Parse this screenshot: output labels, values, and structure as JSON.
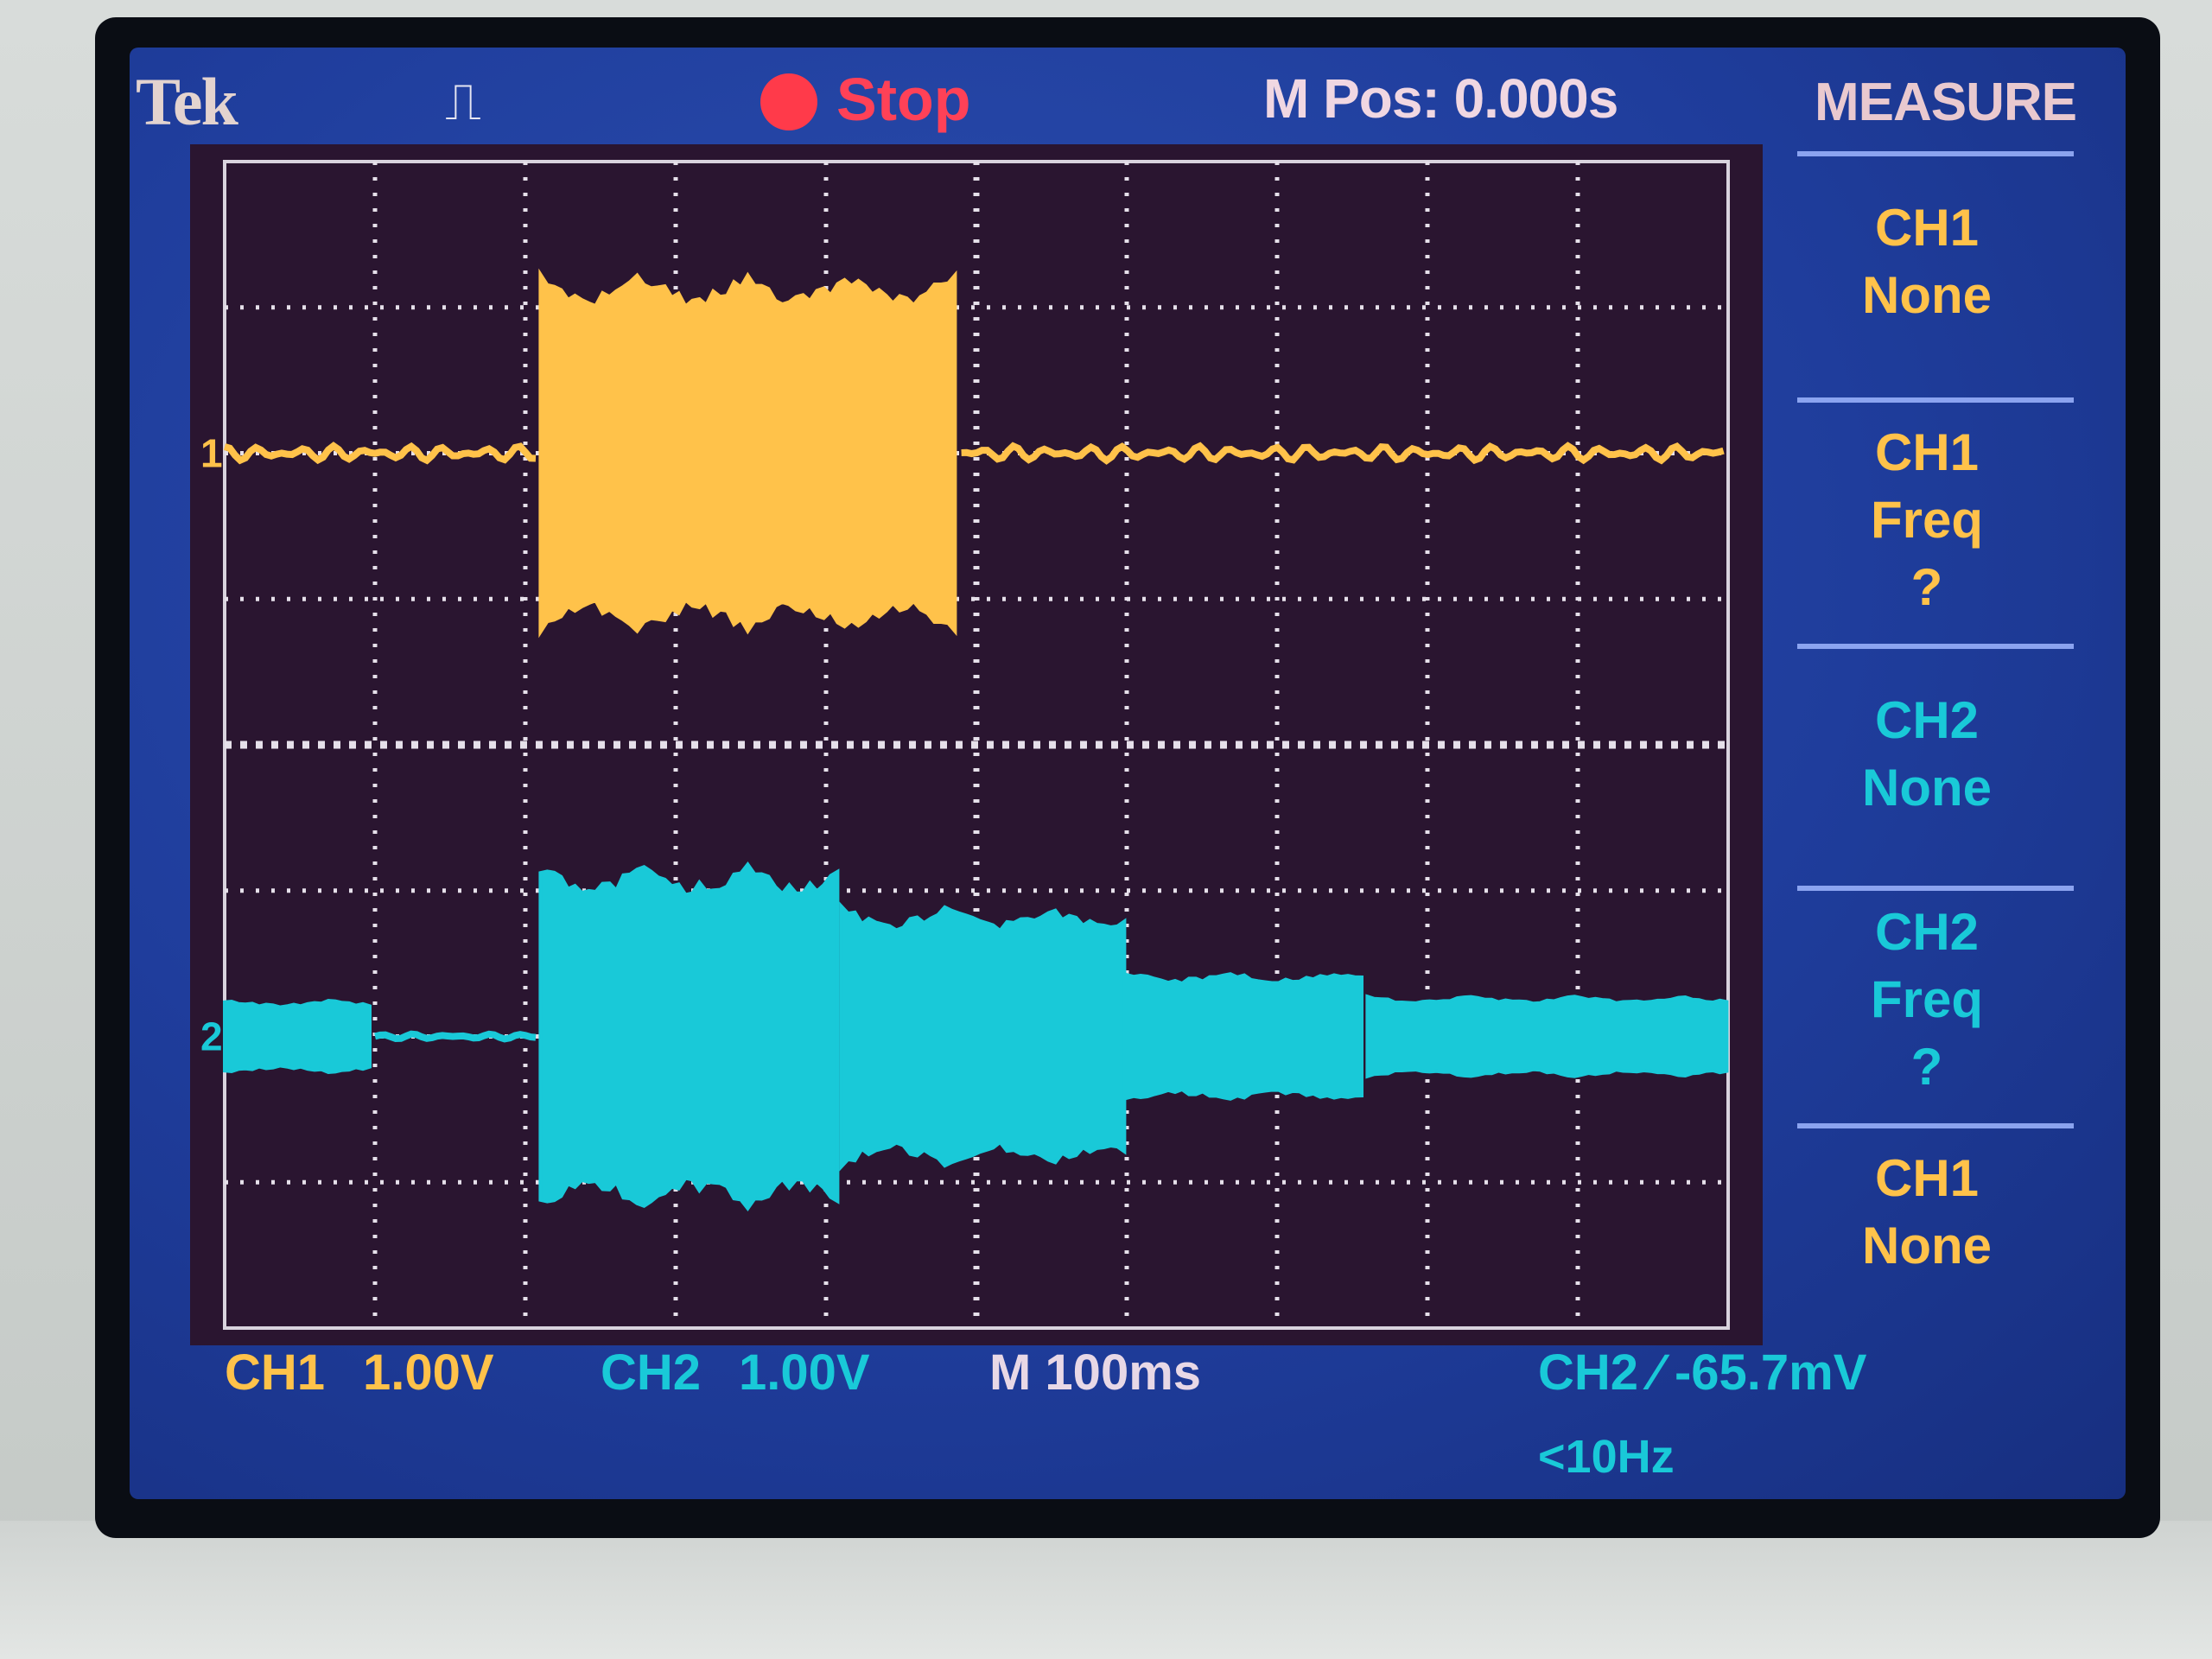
{
  "header": {
    "brand": "Tek",
    "trigger_glyph": "⎍",
    "run_state": "Stop",
    "horizontal_position": "M Pos: 0.000s"
  },
  "channels": {
    "ch1_marker": "1",
    "ch2_marker": "2"
  },
  "menu": {
    "title": "MEASURE",
    "items": [
      {
        "line1": "CH1",
        "line2": "None",
        "line3": "",
        "channel": "ch1"
      },
      {
        "line1": "CH1",
        "line2": "Freq",
        "line3": "?",
        "channel": "ch1"
      },
      {
        "line1": "CH2",
        "line2": "None",
        "line3": "",
        "channel": "ch2"
      },
      {
        "line1": "CH2",
        "line2": "Freq",
        "line3": "?",
        "channel": "ch2"
      },
      {
        "line1": "CH1",
        "line2": "None",
        "line3": "",
        "channel": "ch1"
      }
    ]
  },
  "status": {
    "ch1_label": "CH1",
    "ch1_scale": "1.00V",
    "ch2_label": "CH2",
    "ch2_scale": "1.00V",
    "timebase": "M 100ms",
    "trigger": "CH2 ⁄ -65.7mV",
    "trigger_freq": "<10Hz"
  },
  "colors": {
    "ch1": "#ffc24a",
    "ch2": "#19c9d8",
    "screen_bg": "#1f3d9c",
    "plot_bg": "#2a1530",
    "stop": "#ff3a4a"
  },
  "chart_data": {
    "type": "line",
    "title": "",
    "xlabel": "",
    "ylabel": "",
    "x_divisions": 10,
    "y_divisions": 8,
    "grid": true,
    "series": [
      {
        "name": "CH1",
        "baseline_div": 2.0,
        "segments": [
          {
            "x_start_div": 0.0,
            "x_end_div": 2.1,
            "amplitude_div": 0.05
          },
          {
            "x_start_div": 2.1,
            "x_end_div": 4.9,
            "amplitude_div": 1.25
          },
          {
            "x_start_div": 4.9,
            "x_end_div": 10.0,
            "amplitude_div": 0.05
          }
        ]
      },
      {
        "name": "CH2",
        "baseline_div": 6.0,
        "segments": [
          {
            "x_start_div": 0.0,
            "x_end_div": 1.0,
            "amplitude_div": 0.25
          },
          {
            "x_start_div": 1.0,
            "x_end_div": 2.1,
            "amplitude_div": 0.0
          },
          {
            "x_start_div": 2.1,
            "x_end_div": 4.1,
            "amplitude_div": 1.2
          },
          {
            "x_start_div": 4.1,
            "x_end_div": 6.0,
            "amplitude_div": 0.9
          },
          {
            "x_start_div": 6.0,
            "x_end_div": 7.6,
            "amplitude_div": 0.45
          },
          {
            "x_start_div": 7.6,
            "x_end_div": 10.0,
            "amplitude_div": 0.28
          }
        ]
      }
    ]
  }
}
